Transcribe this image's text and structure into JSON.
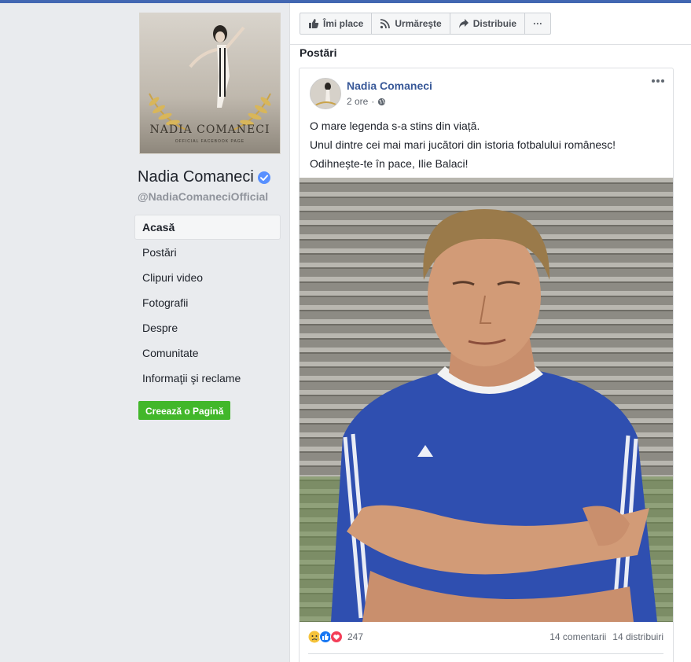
{
  "page": {
    "name": "Nadia Comaneci",
    "handle": "@NadiaComaneciOfficial",
    "cover_title": "NADIA COMANECI",
    "cover_subtitle": "OFFICIAL FACEBOOK PAGE"
  },
  "nav": {
    "items": [
      {
        "label": "Acasă",
        "active": true
      },
      {
        "label": "Postări"
      },
      {
        "label": "Clipuri video"
      },
      {
        "label": "Fotografii"
      },
      {
        "label": "Despre"
      },
      {
        "label": "Comunitate"
      },
      {
        "label": "Informaţii şi reclame"
      }
    ],
    "create_page_label": "Creează o Pagină"
  },
  "actions": {
    "like": "Îmi place",
    "follow": "Urmăreşte",
    "share": "Distribuie",
    "more": "···"
  },
  "section_title": "Postări",
  "post": {
    "author": "Nadia Comaneci",
    "time": "2 ore",
    "separator": "·",
    "lines": [
      "O mare legenda s-a stins din viață.",
      "Unul dintre cei mai mari jucători din istoria fotbalului românesc!",
      "Odihnește-te în pace, Ilie Balaci!"
    ],
    "reaction_count": "247",
    "comments": "14 comentarii",
    "shares": "14 distribuiri"
  },
  "colors": {
    "brand": "#4267b2",
    "link": "#385898",
    "green": "#42b72a",
    "verified": "#5890ff"
  }
}
